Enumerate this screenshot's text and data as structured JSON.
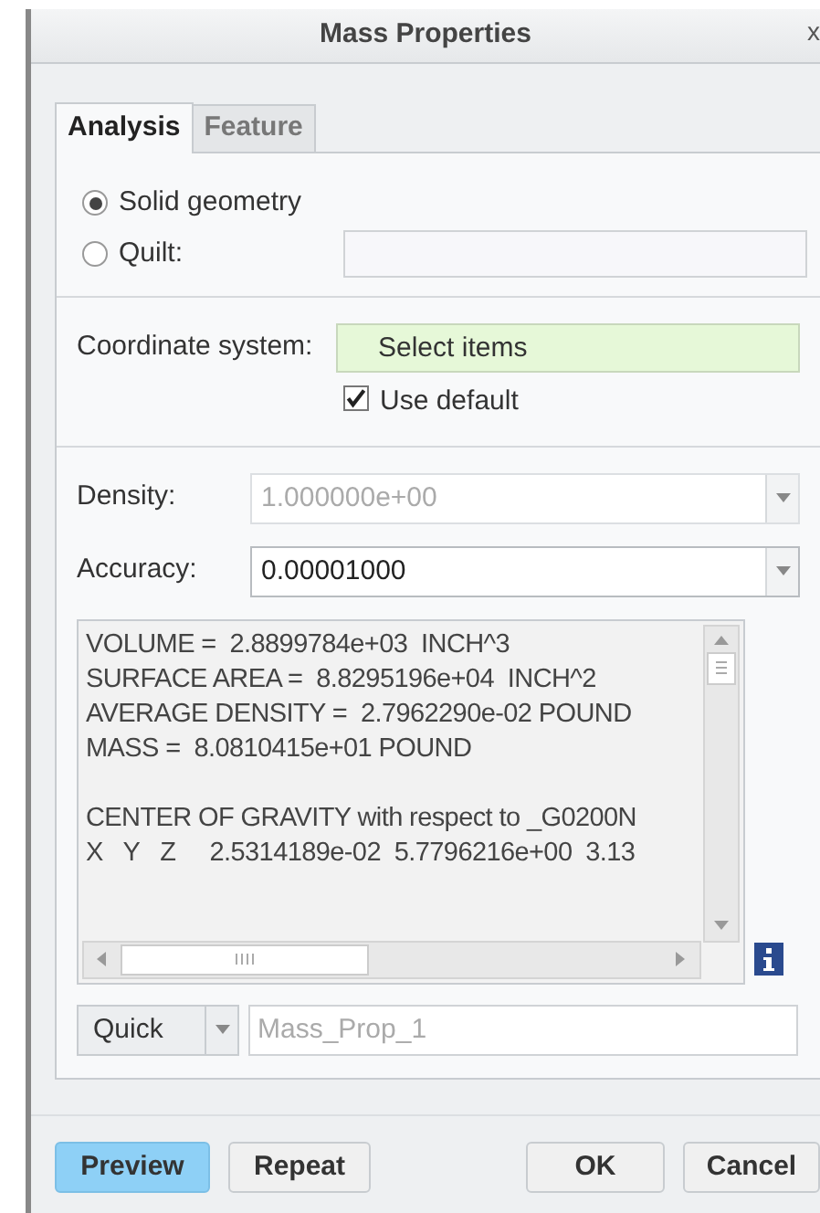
{
  "window": {
    "title": "Mass Properties",
    "close": "x"
  },
  "tabs": [
    {
      "label": "Analysis",
      "selected": true
    },
    {
      "label": "Feature",
      "selected": false
    }
  ],
  "geometry": [
    {
      "label": "Solid geometry",
      "selected": true
    },
    {
      "label": "Quilt:",
      "selected": false
    }
  ],
  "coordinate_system": {
    "label": "Coordinate system:",
    "placeholder": "Select items",
    "use_default": {
      "label": "Use default",
      "checked": true
    }
  },
  "density": {
    "label": "Density:",
    "value": "1.000000e+00",
    "disabled": true
  },
  "accuracy": {
    "label": "Accuracy:",
    "value": "0.00001000",
    "disabled": false
  },
  "results": [
    [
      "VOLUME =  2.8899784e+03  INCH^3",
      "SURFACE AREA =  8.8295196e+04  INCH^2",
      "AVERAGE DENSITY =  2.7962290e-02 POUND",
      "MASS =  8.0810415e+01 POUND"
    ],
    [
      "CENTER OF GRAVITY with respect to _G0200N",
      "X   Y   Z     2.5314189e-02  5.7796216e+00  3.13"
    ]
  ],
  "mode": {
    "value": "Quick"
  },
  "name_field": {
    "placeholder": "Mass_Prop_1"
  },
  "buttons": [
    {
      "label": "Preview",
      "kind": "primary"
    },
    {
      "label": "Repeat",
      "kind": "normal"
    },
    {
      "label": "OK",
      "kind": "normal"
    },
    {
      "label": "Cancel",
      "kind": "normal"
    }
  ]
}
